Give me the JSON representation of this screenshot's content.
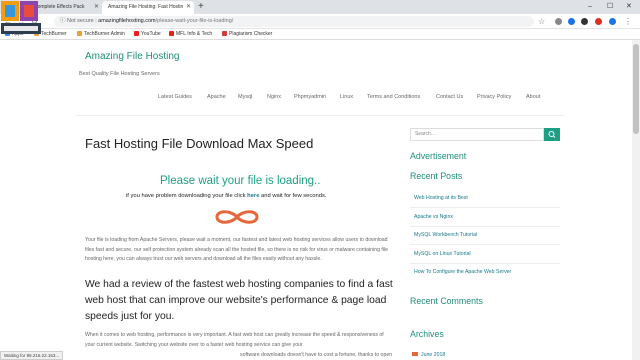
{
  "browser": {
    "tabs": [
      {
        "title": "Complete Effects Pack"
      },
      {
        "title": "Amazing File Hosting: Fast Hostin"
      }
    ],
    "security_label": "Not secure",
    "url_host": "amazingfilehosting.com",
    "url_path": "/please-wait-your-file-is-loading/",
    "bookmarks": [
      {
        "label": "Apps",
        "icon": "apps-grid-icon",
        "color": "#4285f4"
      },
      {
        "label": "TechBurner",
        "icon": "techburner-icon",
        "color": "#e8a03c"
      },
      {
        "label": "TechBurner Admin",
        "icon": "techburner-admin-icon",
        "color": "#e8a03c"
      },
      {
        "label": "YouTube",
        "icon": "youtube-icon",
        "color": "#e62117"
      },
      {
        "label": "MFL Info & Tech",
        "icon": "mfl-icon",
        "color": "#e62117"
      },
      {
        "label": "Plagiarism Checker",
        "icon": "checker-icon",
        "color": "#d23b3b"
      }
    ],
    "status_text": "Waiting for 95.216.22.153..."
  },
  "site": {
    "title": "Amazing File Hosting",
    "description": "Best Quality File Hosting Servers",
    "menu": [
      "Latest Guides",
      "Apache",
      "Mysql",
      "Nginx",
      "Phpmyadmin",
      "Linux",
      "Terms and Conditions",
      "Contact Us",
      "Privacy Policy",
      "About"
    ]
  },
  "post": {
    "title": "Fast Hosting File Download Max Speed",
    "wait_heading": "Please wait your file is loading..",
    "wait_pre": "if you have problem downloading your file click",
    "wait_link": "here",
    "wait_post": "and wait for few seconds.",
    "para1": "Your file is loading from Apache Servers, please wait a moment, our fastest and latest web hosting services allow users to download files fast and secure, our self protection system already scan all the hosted file, so there is no risk for virus or malware containing file hosting here, you can always trust our web servers and download all the files easily without any hassle.",
    "big_heading": "We had a review of the fastest web hosting companies to find a fast web host that can improve our website's performance & page load speeds just for you.",
    "para2": "When it comes to web hosting, performance is very important. A fast web host can greatly increase the speed & responsiveness of your current website. Switching your website over to a faster web hosting service can give your",
    "para2_tail": "software downloads doesn't have to cost a fortune, thanks to open"
  },
  "sidebar": {
    "search_placeholder": "Search...",
    "advertisement": "Advertisement",
    "recent_posts_title": "Recent Posts",
    "recent_posts": [
      "Web Hosting at its Best",
      "Apache vs Nginx",
      "MySQL Workbench Tutorial",
      "MySQL on Linux Tutorial",
      "How To Configure the Apache Web Server"
    ],
    "recent_comments_title": "Recent Comments",
    "archives_title": "Archives",
    "archive_item": "June 2018"
  },
  "colors": {
    "accent": "#1e9e84",
    "link": "#16798a",
    "heading": "#222222"
  }
}
